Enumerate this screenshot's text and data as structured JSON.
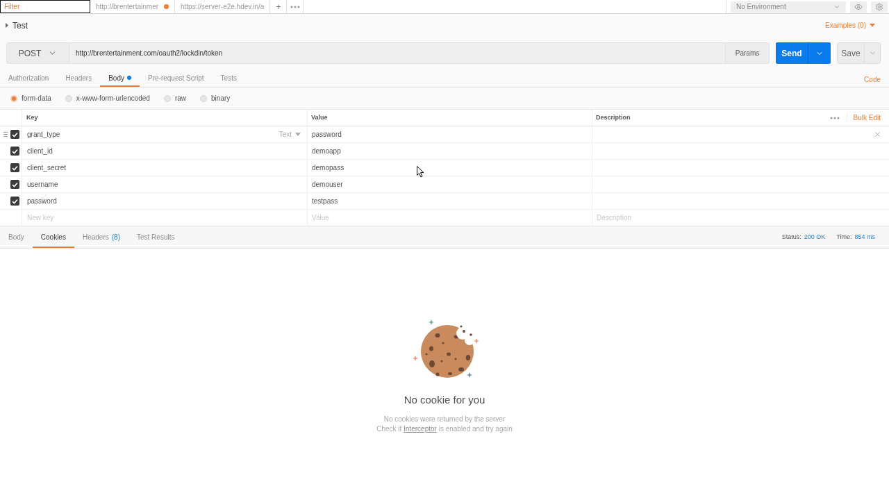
{
  "top_bar": {
    "filter": {
      "placeholder": "Filter"
    },
    "tabs": [
      {
        "label": "http://brentertainmer",
        "modified": true
      },
      {
        "label": "https://server-e2e.hdev.in/a",
        "modified": false
      }
    ],
    "new_tab": "+",
    "environment": "No Environment"
  },
  "request": {
    "name": "Test",
    "examples": "Examples (0)",
    "method": "POST",
    "url": "http://brentertainment.com/oauth2/lockdin/token",
    "params": "Params",
    "send": "Send",
    "save": "Save"
  },
  "request_tabs": [
    {
      "label": "Authorization",
      "selected": false,
      "dot": false
    },
    {
      "label": "Headers",
      "selected": false,
      "dot": false
    },
    {
      "label": "Body",
      "selected": true,
      "dot": true
    },
    {
      "label": "Pre-request Script",
      "selected": false,
      "dot": false
    },
    {
      "label": "Tests",
      "selected": false,
      "dot": false
    }
  ],
  "code_link": "Code",
  "body_modes": [
    {
      "label": "form-data",
      "selected": true
    },
    {
      "label": "x-www-form-urlencoded",
      "selected": false
    },
    {
      "label": "raw",
      "selected": false
    },
    {
      "label": "binary",
      "selected": false
    }
  ],
  "params_table": {
    "columns": [
      "Key",
      "Value",
      "Description"
    ],
    "bulk_edit": "Bulk Edit",
    "rows": [
      {
        "checked": true,
        "hovered": true,
        "key": "grant_type",
        "type": "Text",
        "value": "password"
      },
      {
        "checked": true,
        "hovered": false,
        "key": "client_id",
        "value": "demoapp"
      },
      {
        "checked": true,
        "hovered": false,
        "key": "client_secret",
        "value": "demopass"
      },
      {
        "checked": true,
        "hovered": false,
        "key": "username",
        "value": "demouser"
      },
      {
        "checked": true,
        "hovered": false,
        "key": "password",
        "value": "testpass"
      }
    ],
    "new_row": {
      "key_placeholder": "New key",
      "value_placeholder": "Value",
      "description_placeholder": "Description"
    }
  },
  "response": {
    "tabs": [
      {
        "label": "Body",
        "selected": false
      },
      {
        "label": "Cookies",
        "selected": true
      },
      {
        "label": "Headers",
        "count": "(8)",
        "selected": false
      },
      {
        "label": "Test Results",
        "selected": false
      }
    ],
    "status_label": "Status:",
    "status": "200 OK",
    "time_label": "Time:",
    "time": "854 ms",
    "empty_state": {
      "title": "No cookie for you",
      "line1": "No cookies were returned by the server",
      "line2_before": "Check if",
      "link": "Interceptor",
      "line2_after": "is enabled and try again"
    }
  }
}
